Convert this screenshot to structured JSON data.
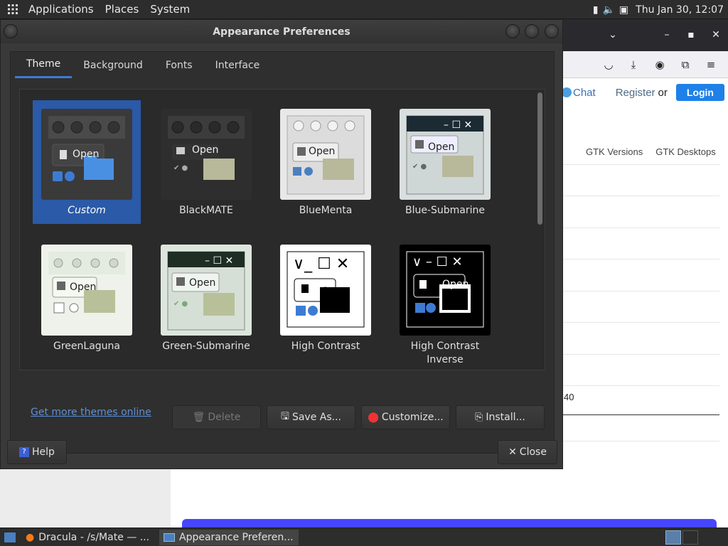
{
  "top_panel": {
    "menus": [
      "Applications",
      "Places",
      "System"
    ],
    "clock": "Thu Jan 30, 12:07"
  },
  "browser": {
    "chat_label": "Chat",
    "register_label": "Register",
    "or_label": "or",
    "login_label": "Login",
    "tabs": [
      "GTK Versions",
      "GTK Desktops"
    ],
    "page_number": "40"
  },
  "dialog": {
    "title": "Appearance Preferences",
    "tabs": [
      "Theme",
      "Background",
      "Fonts",
      "Interface"
    ],
    "active_tab": "Theme",
    "themes": [
      {
        "name": "Custom",
        "selected": true
      },
      {
        "name": "BlackMATE"
      },
      {
        "name": "BlueMenta"
      },
      {
        "name": "Blue-Submarine"
      },
      {
        "name": "GreenLaguna"
      },
      {
        "name": "Green-Submarine"
      },
      {
        "name": "High Contrast"
      },
      {
        "name": "High Contrast\nInverse"
      }
    ],
    "preview_open_label": "Open",
    "buttons": {
      "delete": "Delete",
      "save_as": "Save As...",
      "customize": "Customize...",
      "install": "Install..."
    },
    "more_link": "Get more themes online",
    "help": "Help",
    "close": "Close"
  },
  "taskbar": {
    "tasks": [
      "Dracula - /s/Mate — ...",
      "Appearance Preferen..."
    ]
  },
  "colors": {
    "accent": "#2a5aa8",
    "login": "#1e80e8",
    "link": "#5d8fd6"
  }
}
